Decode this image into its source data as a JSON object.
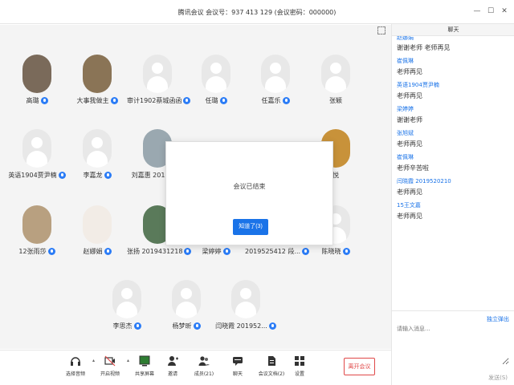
{
  "window": {
    "title": "腾讯会议  会议号：937 413 129   (会议密码：000000)",
    "minimize": "—",
    "maximize": "☐",
    "close": "✕"
  },
  "participants": [
    {
      "name": "高璐",
      "avatar": "photo"
    },
    {
      "name": "大事我做主",
      "avatar": "photo"
    },
    {
      "name": "审计1902蔡城函函",
      "avatar": "default"
    },
    {
      "name": "任璐",
      "avatar": "default"
    },
    {
      "name": "任嘉乐",
      "avatar": "default"
    },
    {
      "name": "张颖",
      "avatar": "default"
    },
    {
      "name": "英语1904贾尹楠",
      "avatar": "default"
    },
    {
      "name": "李嘉龙",
      "avatar": "default"
    },
    {
      "name": "刘嘉惠 201952...",
      "avatar": "photo"
    },
    {
      "name": "悦",
      "avatar": "photo"
    },
    {
      "name": "12张雨莎",
      "avatar": "photo"
    },
    {
      "name": "赵娜娟",
      "avatar": "photo"
    },
    {
      "name": "张扬 2019431218",
      "avatar": "photo"
    },
    {
      "name": "梁婷婷",
      "avatar": "default"
    },
    {
      "name": "2019525412 段...",
      "avatar": "default"
    },
    {
      "name": "陈晓晓",
      "avatar": "default"
    },
    {
      "name": "李思杰",
      "avatar": "default"
    },
    {
      "name": "杨梦昕",
      "avatar": "default"
    },
    {
      "name": "闫晓霞 201952...",
      "avatar": "default"
    }
  ],
  "modal": {
    "message": "会议已结束",
    "ok_label": "知道了(3)"
  },
  "toolbar": {
    "items": [
      {
        "label": "选择音频",
        "icon": "headset-icon"
      },
      {
        "label": "开启视频",
        "icon": "camera-off-icon"
      },
      {
        "label": "共享屏幕",
        "icon": "screen-share-icon"
      },
      {
        "label": "邀请",
        "icon": "invite-icon"
      },
      {
        "label": "成员(21)",
        "icon": "members-icon"
      },
      {
        "label": "聊天",
        "icon": "chat-icon"
      },
      {
        "label": "会议文档(2)",
        "icon": "document-icon"
      },
      {
        "label": "设置",
        "icon": "settings-icon"
      }
    ],
    "leave_label": "离开会议"
  },
  "chat": {
    "title": "聊天",
    "messages": [
      {
        "sender": "赵娜娟",
        "text": "谢谢老师  老师再见"
      },
      {
        "sender": "崔佩琳",
        "text": "老师再见"
      },
      {
        "sender": "英语1904贾尹楠",
        "text": "老师再见"
      },
      {
        "sender": "梁婷婷",
        "text": "谢谢老师"
      },
      {
        "sender": "张旭斌",
        "text": "老师再见"
      },
      {
        "sender": "崔佩琳",
        "text": "老师辛苦啦"
      },
      {
        "sender": "闫晓霞  2019520210",
        "text": "老师再见"
      },
      {
        "sender": "15王文嘉",
        "text": "老师再见"
      }
    ],
    "popout_label": "独立弹出",
    "input_placeholder": "请输入消息...",
    "send_label": "发送(S)"
  },
  "colors": {
    "accent": "#1a73e8",
    "leave": "#e04848",
    "mic_badge": "#2b7cf6"
  }
}
